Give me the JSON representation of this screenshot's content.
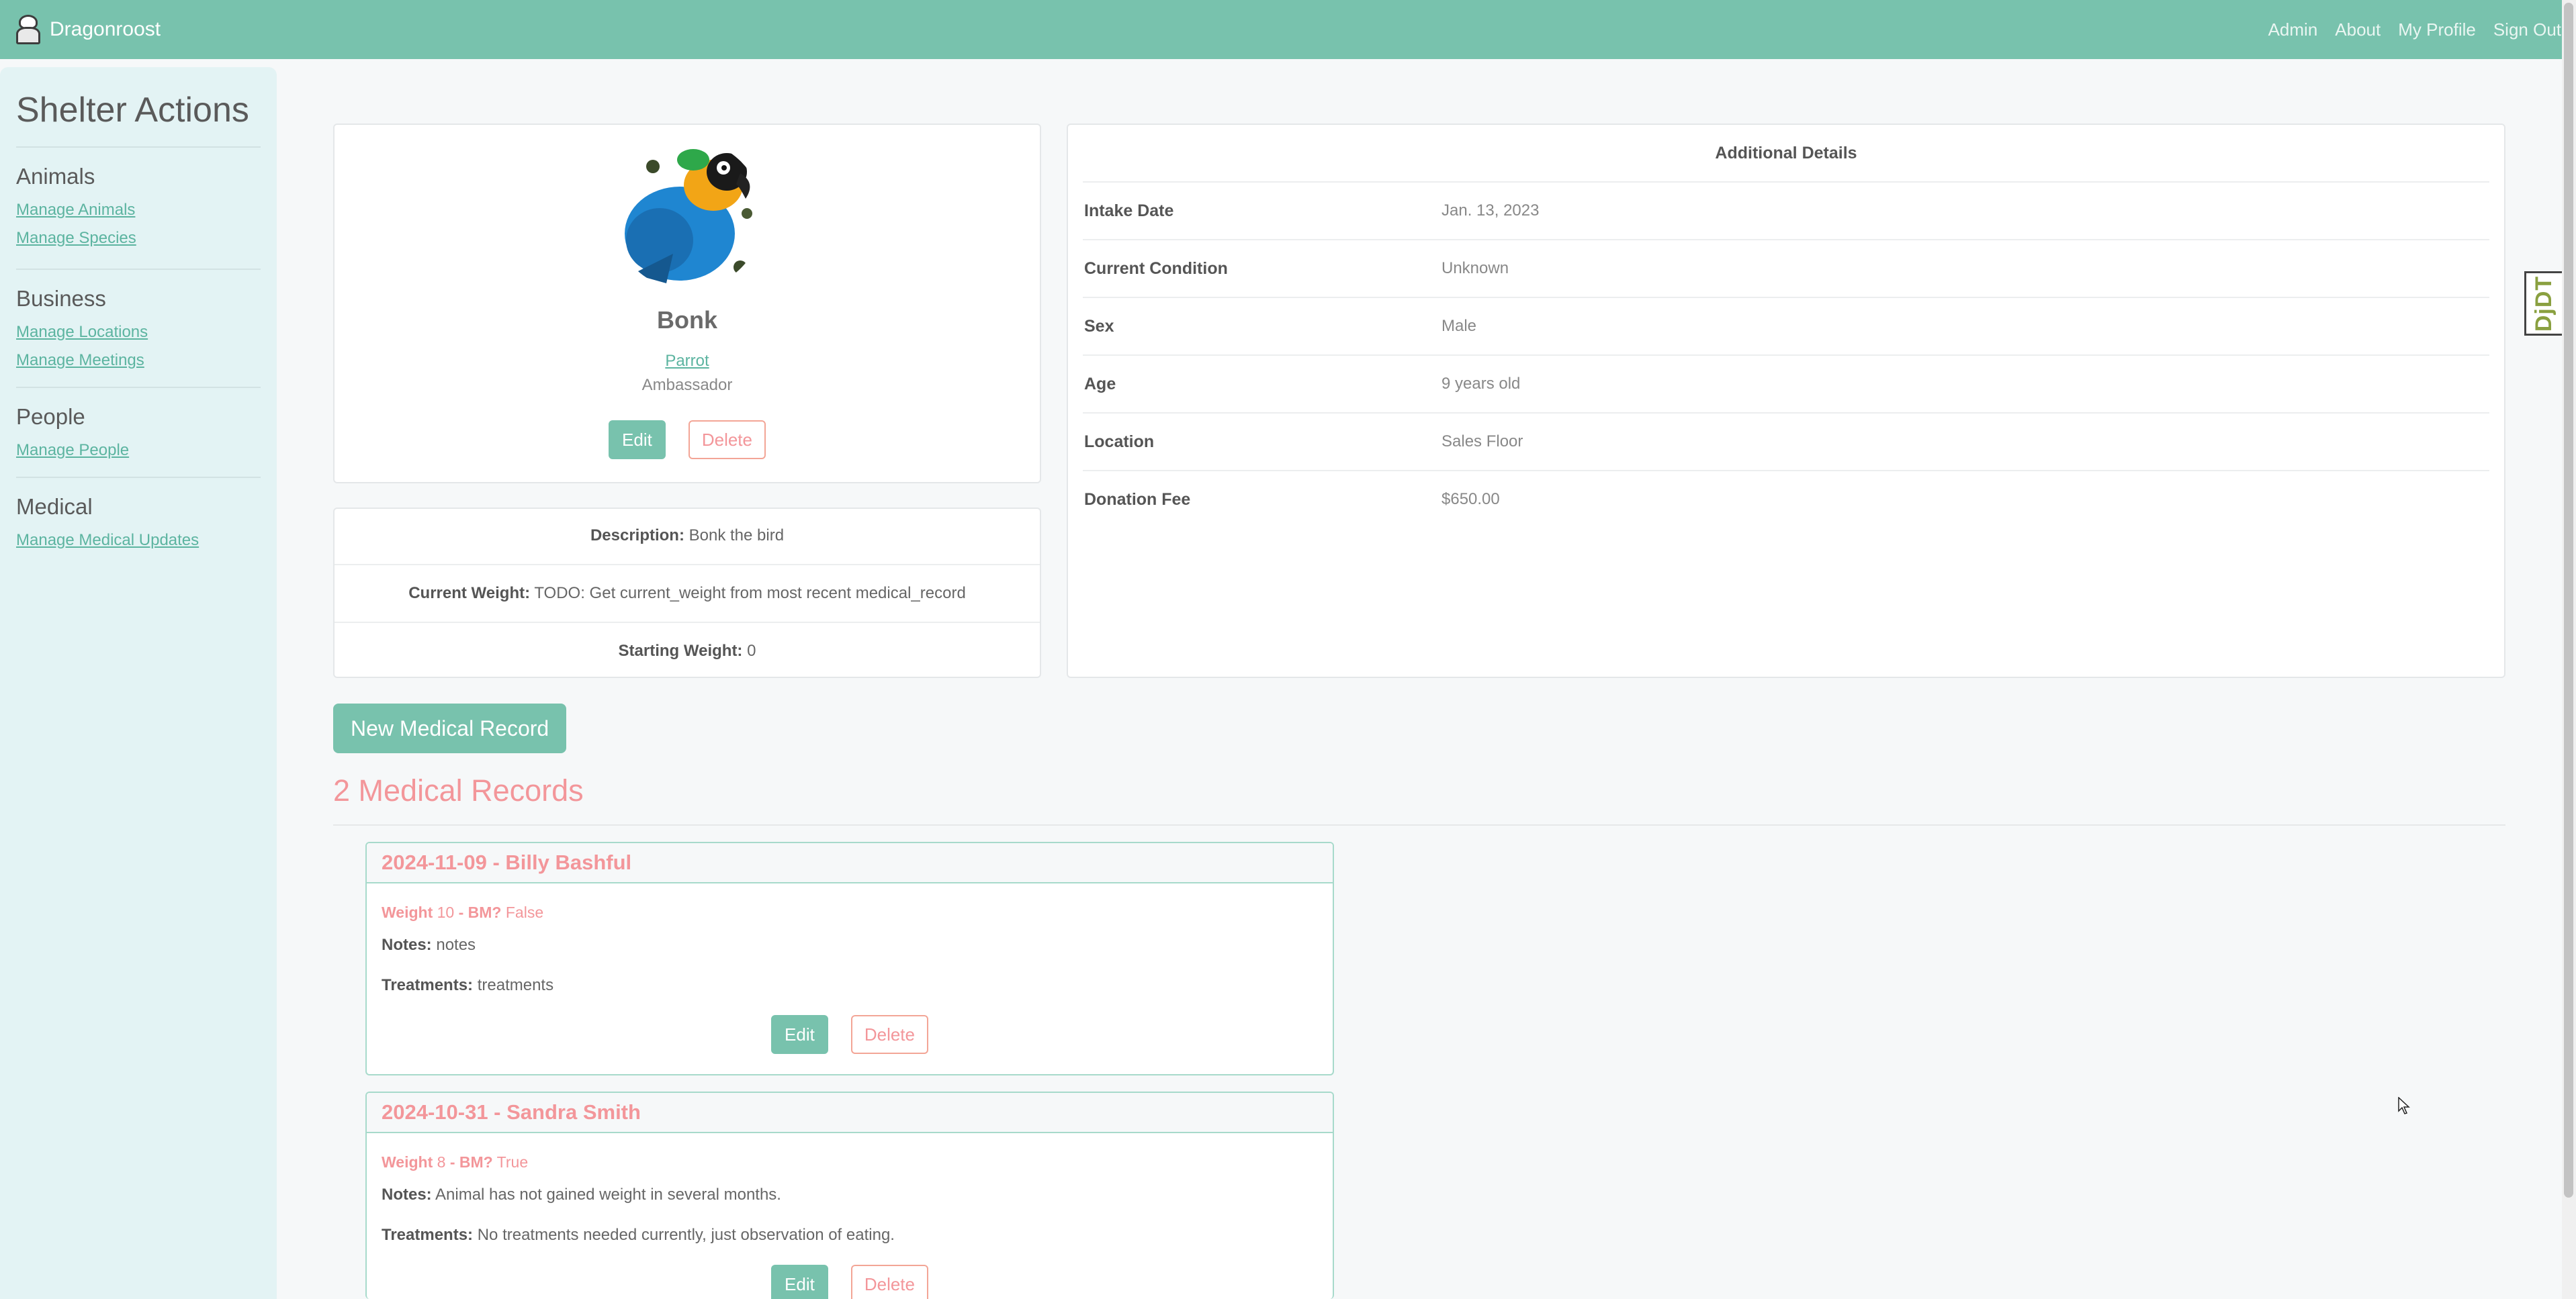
{
  "navbar": {
    "brand": "Dragonroost",
    "links": [
      "Admin",
      "About",
      "My Profile",
      "Sign Out"
    ]
  },
  "sidebar": {
    "title": "Shelter Actions",
    "sections": [
      {
        "heading": "Animals",
        "links": [
          "Manage Animals",
          "Manage Species"
        ]
      },
      {
        "heading": "Business",
        "links": [
          "Manage Locations",
          "Manage Meetings"
        ]
      },
      {
        "heading": "People",
        "links": [
          "Manage People"
        ]
      },
      {
        "heading": "Medical",
        "links": [
          "Manage Medical Updates"
        ]
      }
    ]
  },
  "animal": {
    "name": "Bonk",
    "species": "Parrot",
    "role": "Ambassador",
    "edit_label": "Edit",
    "delete_label": "Delete"
  },
  "description": {
    "description_label": "Description:",
    "description_value": "Bonk the bird",
    "current_weight_label": "Current Weight:",
    "current_weight_value": "TODO: Get current_weight from most recent medical_record",
    "starting_weight_label": "Starting Weight:",
    "starting_weight_value": "0"
  },
  "details": {
    "title": "Additional Details",
    "rows": [
      {
        "label": "Intake Date",
        "value": "Jan. 13, 2023"
      },
      {
        "label": "Current Condition",
        "value": "Unknown"
      },
      {
        "label": "Sex",
        "value": "Male"
      },
      {
        "label": "Age",
        "value": "9 years old"
      },
      {
        "label": "Location",
        "value": "Sales Floor"
      },
      {
        "label": "Donation Fee",
        "value": "$650.00"
      }
    ]
  },
  "medical": {
    "new_button": "New Medical Record",
    "title": "2 Medical Records",
    "records": [
      {
        "heading": "2024-11-09 - Billy Bashful",
        "weight_label": "Weight",
        "weight": "10",
        "bm_label": "- BM?",
        "bm": "False",
        "notes_label": "Notes:",
        "notes": "notes",
        "treatments_label": "Treatments:",
        "treatments": "treatments",
        "edit_label": "Edit",
        "delete_label": "Delete"
      },
      {
        "heading": "2024-10-31 - Sandra Smith",
        "weight_label": "Weight",
        "weight": "8",
        "bm_label": "- BM?",
        "bm": "True",
        "notes_label": "Notes:",
        "notes": "Animal has not gained weight in several months.",
        "treatments_label": "Treatments:",
        "treatments": "No treatments needed currently, just observation of eating.",
        "edit_label": "Edit",
        "delete_label": "Delete"
      }
    ]
  },
  "debug_toolbar": {
    "label": "DjDT"
  },
  "colors": {
    "primary": "#78c2ad",
    "secondary_pink": "#f3969a",
    "sidebar_bg": "#e3f3f4",
    "page_bg": "#f6f8f9"
  }
}
